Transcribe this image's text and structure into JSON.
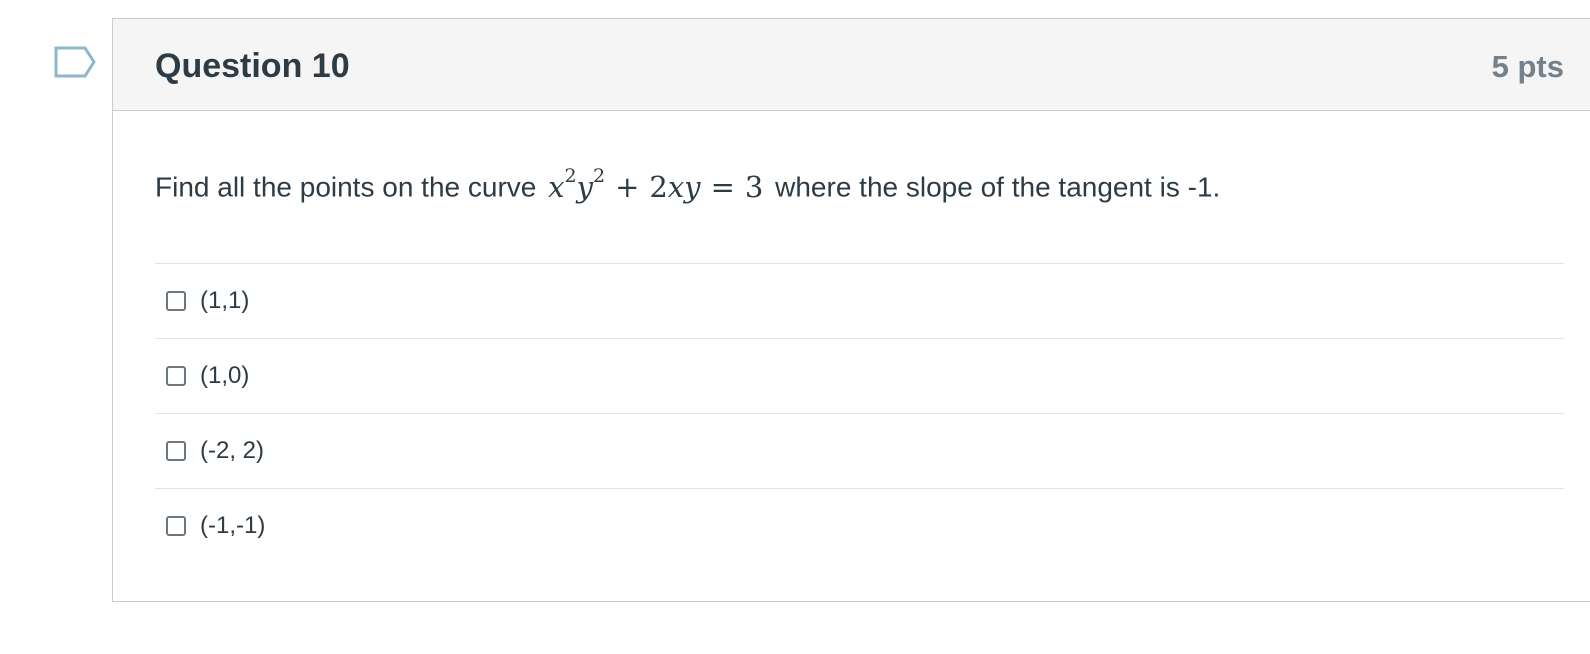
{
  "question": {
    "title": "Question 10",
    "points": "5 pts",
    "text_before": "Find all the points on the curve",
    "equation": {
      "x": "x",
      "y": "y",
      "exp_x": "2",
      "exp_y": "2",
      "plus": "+",
      "coef": "2",
      "xy": "xy",
      "equals": "=",
      "rhs": "3"
    },
    "text_after": "where the slope of the tangent is -1."
  },
  "answers": [
    {
      "label": "(1,1)",
      "checked": false
    },
    {
      "label": "(1,0)",
      "checked": false
    },
    {
      "label": "(-2, 2)",
      "checked": false
    },
    {
      "label": "(-1,-1)",
      "checked": false
    }
  ],
  "colors": {
    "flag": "#8eb6cc",
    "header_bg": "#f5f5f5",
    "text": "#2d3b45",
    "points": "#73818c",
    "border": "#c7cdd1"
  }
}
